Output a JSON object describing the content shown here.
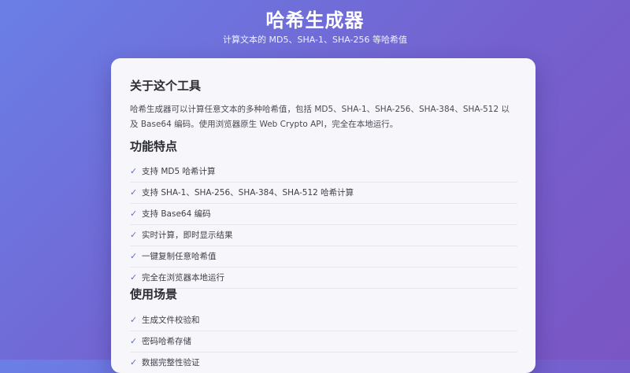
{
  "header": {
    "title": "哈希生成器",
    "subtitle": "计算文本的 MD5、SHA-1、SHA-256 等哈希值"
  },
  "about": {
    "heading": "关于这个工具",
    "description": "哈希生成器可以计算任意文本的多种哈希值，包括 MD5、SHA-1、SHA-256、SHA-384、SHA-512 以及 Base64 编码。使用浏览器原生 Web Crypto API，完全在本地运行。"
  },
  "features": {
    "heading": "功能特点",
    "items": [
      "支持 MD5 哈希计算",
      "支持 SHA-1、SHA-256、SHA-384、SHA-512 哈希计算",
      "支持 Base64 编码",
      "实时计算，即时显示结果",
      "一键复制任意哈希值",
      "完全在浏览器本地运行"
    ]
  },
  "usecases": {
    "heading": "使用场景",
    "items": [
      "生成文件校验和",
      "密码哈希存储",
      "数据完整性验证"
    ]
  },
  "icons": {
    "check": "check-icon",
    "check_glyph": "✓"
  },
  "colors": {
    "accent": "#5b6fd8",
    "bg_start": "#6a7fe6",
    "bg_end": "#7a56c4"
  }
}
